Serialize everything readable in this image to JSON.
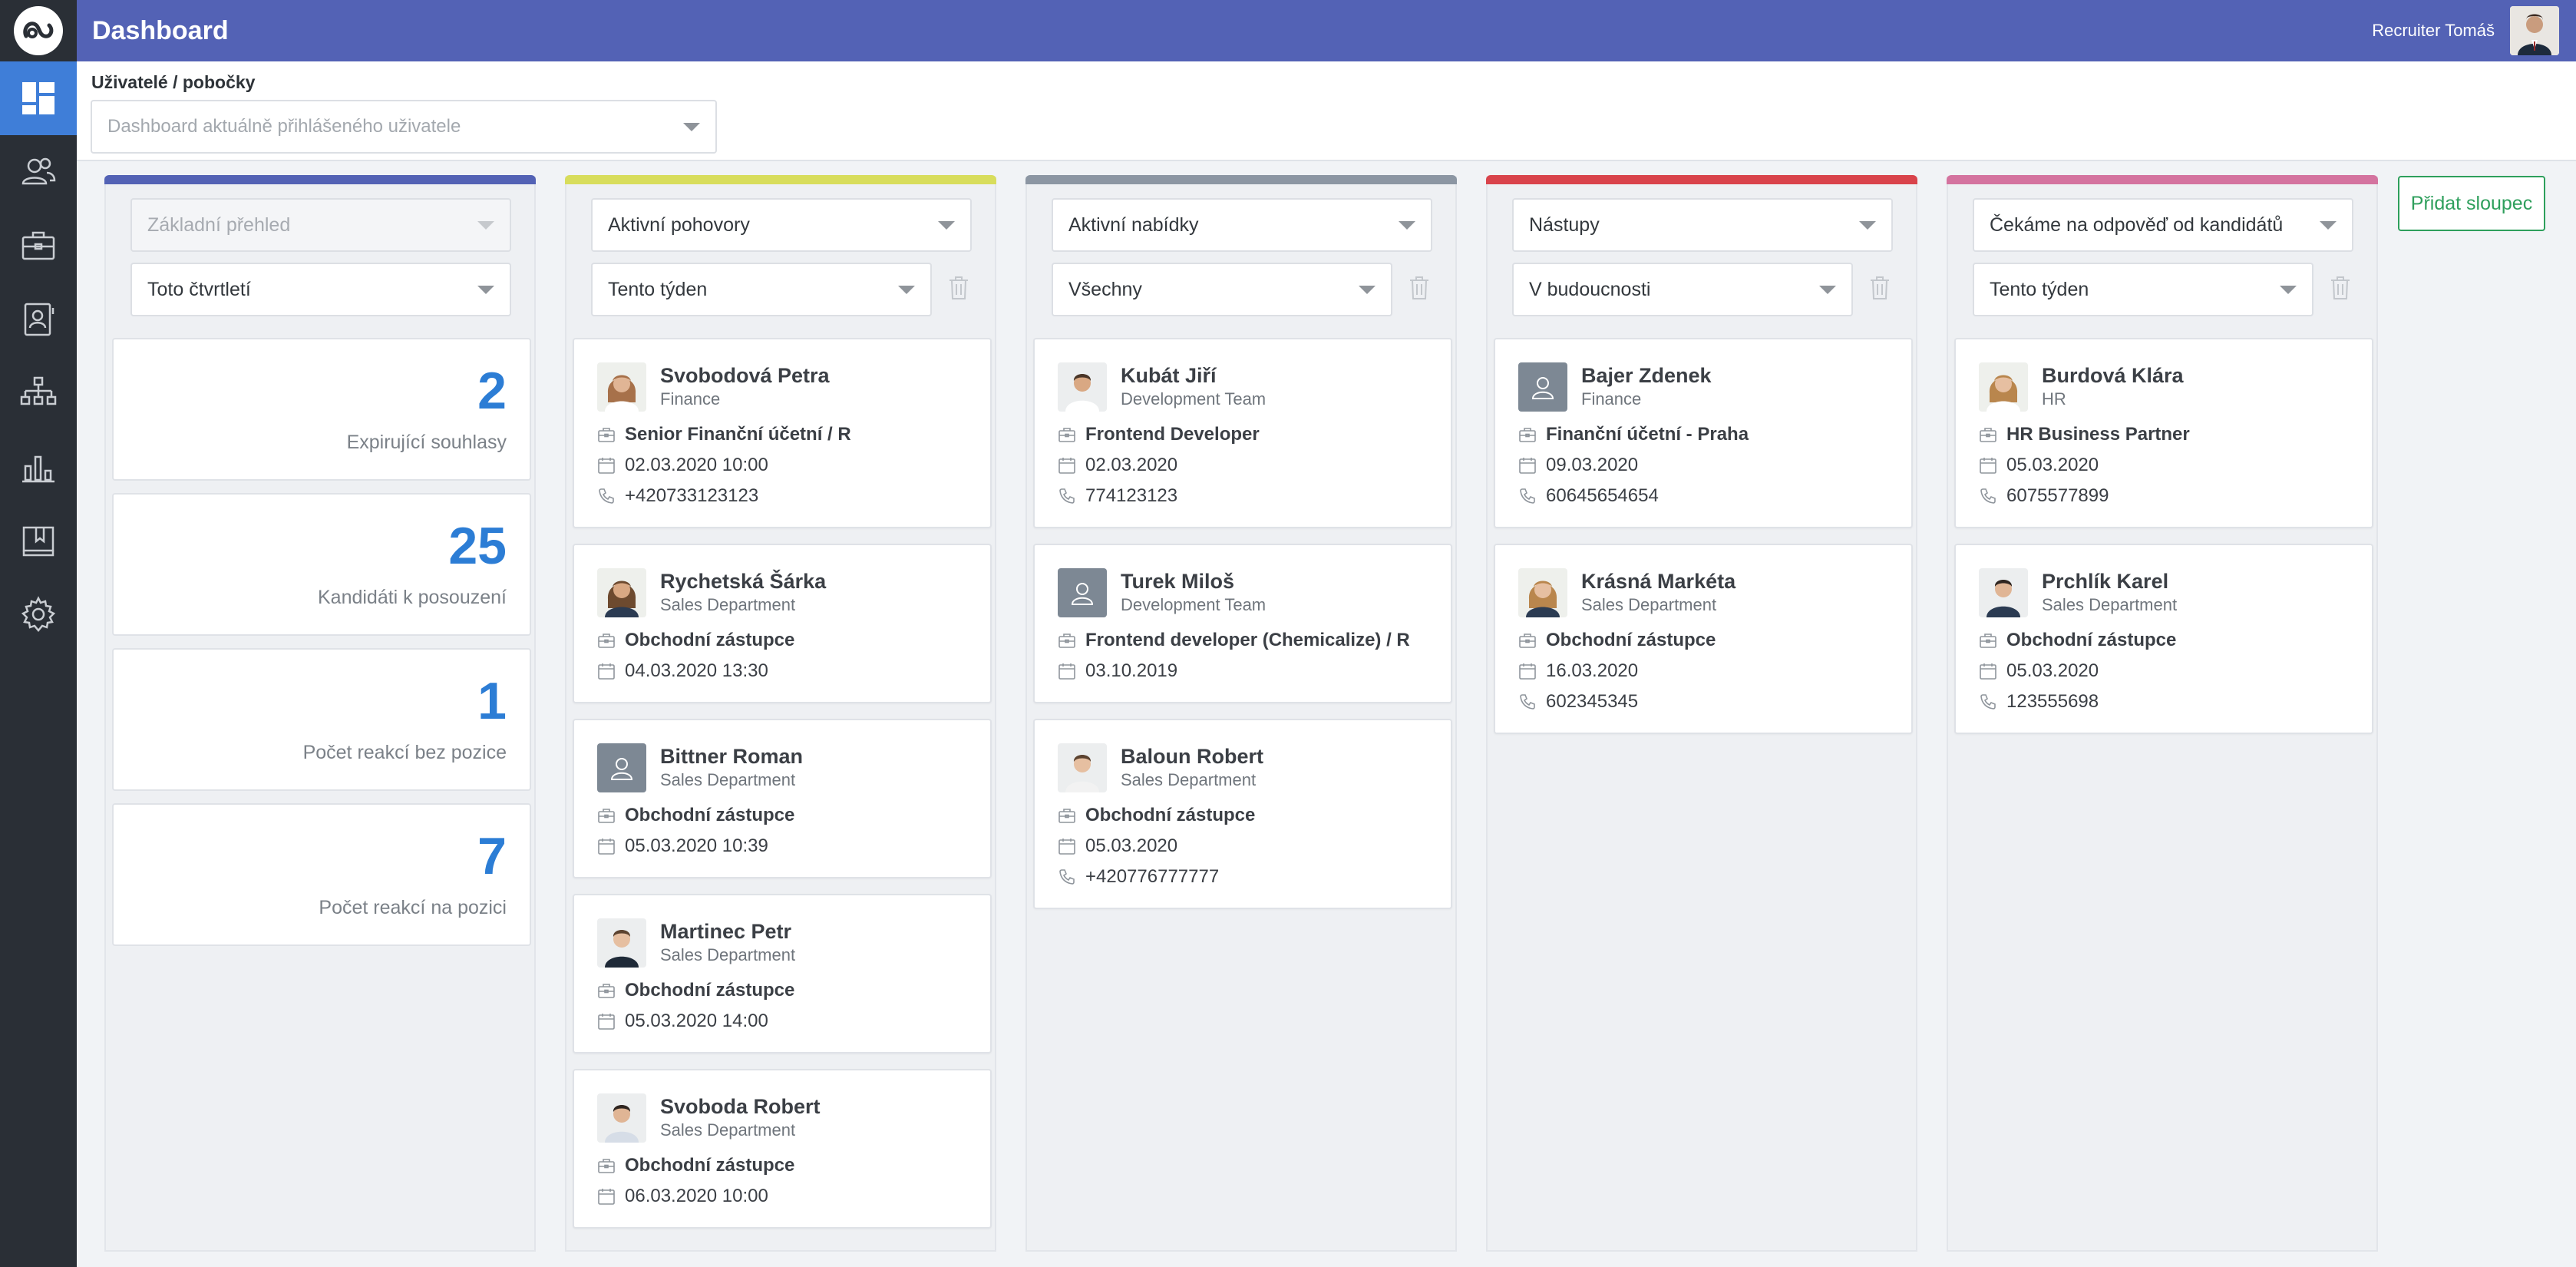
{
  "header": {
    "title": "Dashboard",
    "user_name": "Recruiter Tomáš",
    "color": "#5362b5"
  },
  "sidebar": {
    "items": [
      {
        "icon": "dashboard-icon",
        "active": true
      },
      {
        "icon": "users-icon"
      },
      {
        "icon": "briefcase-icon"
      },
      {
        "icon": "contacts-icon"
      },
      {
        "icon": "org-chart-icon"
      },
      {
        "icon": "bar-chart-icon"
      },
      {
        "icon": "book-icon"
      },
      {
        "icon": "gear-icon"
      }
    ]
  },
  "filter": {
    "label": "Uživatelé / pobočky",
    "placeholder": "Dashboard aktuálně přihlášeného uživatele"
  },
  "add_column_label": "Přidat sloupec",
  "stats_column": {
    "color": "#5362b5",
    "select1": "Základní přehled",
    "select2": "Toto čtvrtletí",
    "stats": [
      {
        "value": "2",
        "label": "Expirující souhlasy"
      },
      {
        "value": "25",
        "label": "Kandidáti k posouzení"
      },
      {
        "value": "1",
        "label": "Počet reakcí bez pozice"
      },
      {
        "value": "7",
        "label": "Počet reakcí na pozici"
      }
    ]
  },
  "columns": [
    {
      "color": "#d8dd5c",
      "select1": "Aktivní pohovory",
      "select2": "Tento týden",
      "cards": [
        {
          "name": "Svobodová Petra",
          "dept": "Finance",
          "position": "Senior Finanční účetní / R",
          "date": "02.03.2020 10:00",
          "phone": "+420733123123",
          "avatar": "female"
        },
        {
          "name": "Rychetská Šárka",
          "dept": "Sales Department",
          "position": "Obchodní zástupce",
          "date": "04.03.2020 13:30",
          "avatar": "female"
        },
        {
          "name": "Bittner Roman",
          "dept": "Sales Department",
          "position": "Obchodní zástupce",
          "date": "05.03.2020 10:39",
          "avatar": "placeholder"
        },
        {
          "name": "Martinec Petr",
          "dept": "Sales Department",
          "position": "Obchodní zástupce",
          "date": "05.03.2020 14:00",
          "avatar": "male"
        },
        {
          "name": "Svoboda Robert",
          "dept": "Sales Department",
          "position": "Obchodní zástupce",
          "date": "06.03.2020 10:00",
          "avatar": "male"
        }
      ]
    },
    {
      "color": "#8c96a3",
      "select1": "Aktivní nabídky",
      "select2": "Všechny",
      "cards": [
        {
          "name": "Kubát Jiří",
          "dept": "Development Team",
          "position": "Frontend Developer",
          "date": "02.03.2020",
          "phone": "774123123",
          "avatar": "male"
        },
        {
          "name": "Turek Miloš",
          "dept": "Development Team",
          "position": "Frontend developer (Chemicalize) / R",
          "date": "03.10.2019",
          "avatar": "placeholder"
        },
        {
          "name": "Baloun Robert",
          "dept": "Sales Department",
          "position": "Obchodní zástupce",
          "date": "05.03.2020",
          "phone": "+420776777777",
          "avatar": "male"
        }
      ]
    },
    {
      "color": "#d9434b",
      "select1": "Nástupy",
      "select2": "V budoucnosti",
      "cards": [
        {
          "name": "Bajer Zdenek",
          "dept": "Finance",
          "position": "Finanční účetní - Praha",
          "date": "09.03.2020",
          "phone": "60645654654",
          "avatar": "placeholder"
        },
        {
          "name": "Krásná Markéta",
          "dept": "Sales Department",
          "position": "Obchodní zástupce",
          "date": "16.03.2020",
          "phone": "602345345",
          "avatar": "female"
        }
      ]
    },
    {
      "color": "#d4739f",
      "select1": "Čekáme na odpověď od kandidátů",
      "select2": "Tento týden",
      "cards": [
        {
          "name": "Burdová Klára",
          "dept": "HR",
          "position": "HR Business Partner",
          "date": "05.03.2020",
          "phone": "6075577899",
          "avatar": "female"
        },
        {
          "name": "Prchlík Karel",
          "dept": "Sales Department",
          "position": "Obchodní zástupce",
          "date": "05.03.2020",
          "phone": "123555698",
          "avatar": "male"
        }
      ]
    }
  ]
}
